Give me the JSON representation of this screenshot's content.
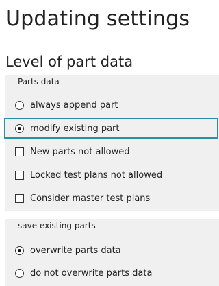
{
  "header": {
    "title": "Updating settings"
  },
  "section": {
    "title": "Level of part data"
  },
  "parts_data_group": {
    "caption": "Parts data",
    "radios": [
      {
        "label": "always append part",
        "checked": false
      },
      {
        "label": "modify existing part",
        "checked": true
      }
    ],
    "checkboxes": [
      {
        "label": "New parts not allowed",
        "checked": false
      },
      {
        "label": "Locked test plans not allowed",
        "checked": false
      },
      {
        "label": "Consider master test plans",
        "checked": false
      }
    ]
  },
  "save_existing_group": {
    "caption": "save existing parts",
    "radios": [
      {
        "label": "overwrite parts data",
        "checked": true
      },
      {
        "label": "do not overwrite parts data",
        "checked": false
      }
    ]
  },
  "colors": {
    "focus": "#2a8fa8",
    "panel_bg": "#f0f0f0"
  }
}
